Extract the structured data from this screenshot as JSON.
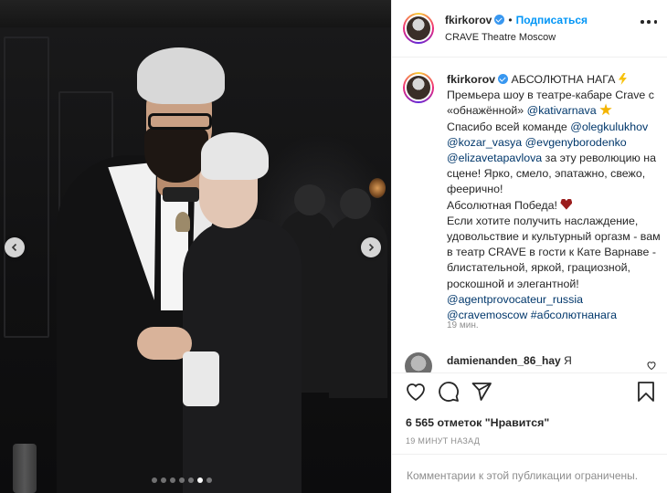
{
  "post": {
    "username": "fkirkorov",
    "separator": "•",
    "follow_label": "Подписаться",
    "location": "CRAVE Theatre Moscow",
    "carousel": {
      "count": 7,
      "active_index": 5
    }
  },
  "caption": {
    "username": "fkirkorov",
    "title": "АБСОЛЮТНА НАГА",
    "line1": "Премьера шоу в театре-кабаре Crave с «обнажённой»",
    "mention_katya": "@kativarnava",
    "line2": "Спасибо всей команде",
    "mention_oleg": "@olegkulukhov",
    "mention_kozar": "@kozar_vasya",
    "mention_evgeny": "@evgenyborodenko",
    "mention_elizaveta": "@elizavetapavlova",
    "line3": "за эту революцию на сцене! Ярко, смело, эпатажно, свежо, феерично!",
    "line4": "Абсолютная Победа!",
    "line5": "Если хотите получить наслаждение, удовольствие и культурный оргазм - вам в театр CRAVE в гости к Кате Варнаве - блистательной, яркой, грациозной, роскошной и элегантной!",
    "mention_agent": "@agentprovocateur_russia",
    "mention_crave": "@cravemoscow",
    "hashtag": "#абсолютнанага",
    "time": "19 мин."
  },
  "comment": {
    "username": "damienanden_86_hay",
    "text": "Я"
  },
  "likes_text": "6 565 отметок \"Нравится\"",
  "date_text": "19 МИНУТ НАЗАД",
  "comments_restricted": "Комментарии к этой публикации ограничены.",
  "colors": {
    "accent": "#0095f6",
    "mention": "#00376b",
    "muted": "#8e8e8e",
    "text": "#262626"
  }
}
